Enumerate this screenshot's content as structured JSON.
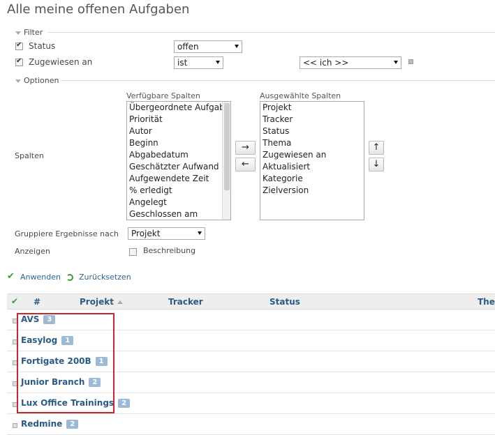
{
  "page": {
    "title": "Alle meine offenen Aufgaben"
  },
  "filter": {
    "legend": "Filter",
    "status": {
      "label": "Status",
      "checked": true,
      "value": "offen"
    },
    "assigned": {
      "label": "Zugewiesen an",
      "checked": true,
      "operator": "ist",
      "value": "<< ich >>"
    }
  },
  "options": {
    "legend": "Optionen",
    "columns_label": "Spalten",
    "available_label": "Verfügbare Spalten",
    "selected_label": "Ausgewählte Spalten",
    "available": [
      "Übergeordnete Aufgabe",
      "Priorität",
      "Autor",
      "Beginn",
      "Abgabedatum",
      "Geschätzter Aufwand",
      "Aufgewendete Zeit",
      "% erledigt",
      "Angelegt",
      "Geschlossen am"
    ],
    "selected": [
      "Projekt",
      "Tracker",
      "Status",
      "Thema",
      "Zugewiesen an",
      "Aktualisiert",
      "Kategorie",
      "Zielversion"
    ],
    "move_right": "→",
    "move_left": "←",
    "move_up": "↑",
    "move_down": "↓",
    "group_by_label": "Gruppiere Ergebnisse nach",
    "group_by_value": "Projekt",
    "show_label": "Anzeigen",
    "show_description": "Beschreibung"
  },
  "actions": {
    "apply": "Anwenden",
    "reset": "Zurücksetzen"
  },
  "table": {
    "columns": [
      "#",
      "Projekt",
      "Tracker",
      "Status",
      "The"
    ],
    "groups": [
      {
        "name": "AVS",
        "count": "3"
      },
      {
        "name": "Easylog",
        "count": "1"
      },
      {
        "name": "Fortigate 200B",
        "count": "1"
      },
      {
        "name": "Junior Branch",
        "count": "2"
      },
      {
        "name": "Lux Office Trainings",
        "count": "2"
      },
      {
        "name": "Redmine",
        "count": "2"
      }
    ]
  }
}
